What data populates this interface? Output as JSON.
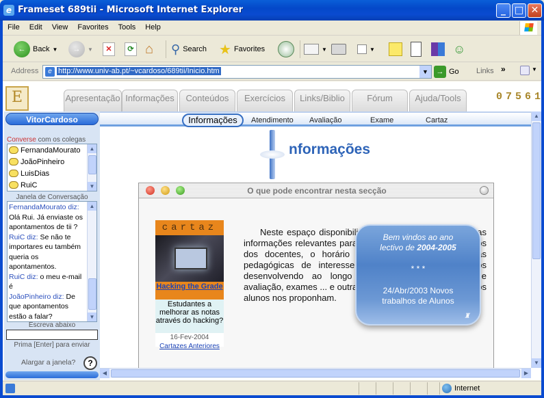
{
  "window": {
    "title": "Frameset 689tii - Microsoft Internet Explorer"
  },
  "menu": [
    "File",
    "Edit",
    "View",
    "Favorites",
    "Tools",
    "Help"
  ],
  "toolbar": {
    "back": "Back",
    "search": "Search",
    "favorites": "Favorites"
  },
  "address": {
    "label": "Address",
    "url": "http://www.univ-ab.pt/~vcardoso/689tii/Inicio.htm",
    "go": "Go",
    "links": "Links"
  },
  "site": {
    "tabs": [
      "Apresentação",
      "Informações",
      "Conteúdos",
      "Exercícios",
      "Links/Biblio",
      "Fórum",
      "Ajuda/Tools"
    ],
    "counter": "07561",
    "subnav": [
      "Informações",
      "Atendimento",
      "Avaliação",
      "Exame",
      "Cartaz"
    ],
    "page_title": "nformações"
  },
  "sidebar": {
    "username": "VitorCardoso",
    "converse_label": "Converse",
    "converse_rest": "com os colegas",
    "contacts": [
      "FernandaMourato",
      "JoãoPinheiro",
      "LuisDias",
      "RuiC"
    ],
    "janela_label": "Janela de Conversação",
    "chat": [
      {
        "user": "FernandaMourato diz:",
        "text": "Olá Rui. Já enviaste os apontamentos de tii ?"
      },
      {
        "user": "RuiC diz:",
        "text": "Se não te importares eu também queria os apontamentos."
      },
      {
        "user": "RuiC diz:",
        "text": "o meu e-mail é"
      },
      {
        "user": "JoãoPinheiro diz:",
        "text": "De que apontamentos estão a falar?"
      }
    ],
    "escreva_label": "Escreva abaixo",
    "prima_label": "Prima [Enter] para enviar",
    "alargar_label": "Alargar a janela?",
    "help": "?"
  },
  "panel": {
    "title": "O que pode encontrar nesta secção",
    "poster_head": "cartaz",
    "poster_link": "Hacking the Grade",
    "poster_desc": "Estudantes a melhorar as notas através do hacking?",
    "poster_date": "16-Fev-2004",
    "poster_archive": "Cartazes Anteriores",
    "body": "Neste espaço disponibilizamos aos estudantes algumas informações relevantes para a disciplina, como os contactos dos docentes, o horário de atendimento, as iniciativas pedagógicas de interesse para os alunos que formos desenvolvendo ao longo do ano, os calendários de avaliação, exames ... e outras que eventualmente os próprios alunos nos proponham.",
    "glass_line1": "Bem vindos ao ano",
    "glass_line2a": "lectivo de ",
    "glass_line2b": "2004-2005",
    "glass_stars": "* * *",
    "glass_news1": "24/Abr/2003 Novos",
    "glass_news2": "trabalhos de Alunos"
  },
  "status": {
    "zone": "Internet"
  }
}
